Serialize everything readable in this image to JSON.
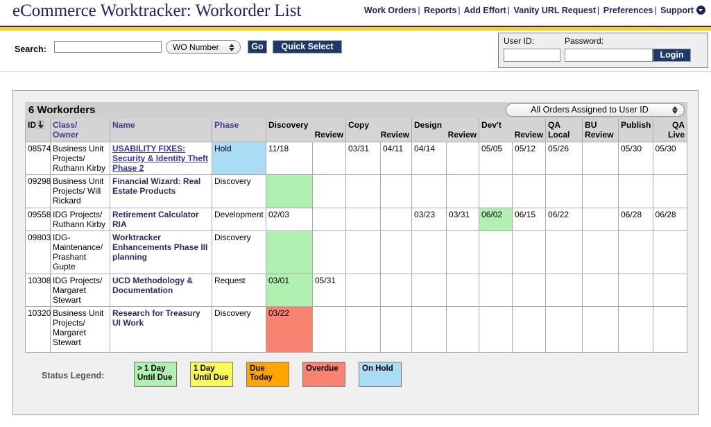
{
  "header": {
    "app_title": "eCommerce Worktracker: Workorder List",
    "nav": [
      {
        "label": "Work Orders"
      },
      {
        "label": "Reports"
      },
      {
        "label": "Add Effort"
      },
      {
        "label": "Vanity URL Request"
      },
      {
        "label": "Preferences"
      },
      {
        "label": "Support"
      }
    ],
    "nav_separator": "|",
    "support_icon": "caret-down-circle-icon"
  },
  "search": {
    "label": "Search:",
    "input_value": "",
    "input_placeholder": "",
    "type_selected": "WO Number",
    "go_label": "Go",
    "quick_select_label": "Quick Select"
  },
  "login": {
    "userid_label": "User ID:",
    "password_label": "Password:",
    "userid_value": "",
    "password_value": "",
    "login_label": "Login"
  },
  "panel": {
    "count_label": "6 Workorders",
    "filter_selected": "All Orders Assigned to User ID"
  },
  "table": {
    "columns": [
      {
        "main": "ID",
        "sub": "",
        "link": false,
        "sorted": true
      },
      {
        "main": "Class/",
        "sub": "Owner",
        "link": true,
        "sub_align": "left"
      },
      {
        "main": "Name",
        "sub": "",
        "link": true
      },
      {
        "main": "Phase",
        "sub": "",
        "link": true
      },
      {
        "main": "Discovery",
        "sub": "Review",
        "link": false
      },
      {
        "main": "Copy",
        "sub": "Review",
        "link": false
      },
      {
        "main": "Design",
        "sub": "Review",
        "link": false
      },
      {
        "main": "Dev't",
        "sub": "Review",
        "link": false
      },
      {
        "main": "QA Local",
        "sub": "",
        "link": false
      },
      {
        "main": "BU",
        "sub": "Review",
        "link": false,
        "sub_align": "left"
      },
      {
        "main": "Publish",
        "sub": "",
        "link": false
      },
      {
        "main": "",
        "sub": "QA Live",
        "link": false
      }
    ],
    "rows": [
      {
        "id": "08574",
        "owner": "Business Unit Projects/ Ruthann Kirby",
        "name": "USABILITY FIXES: Security & Identity Theft Phase 2",
        "name_is_link": true,
        "phase": "Hold",
        "phase_color": "bg-blue",
        "discovery": "11/18",
        "discovery_color": "",
        "discovery_review": "",
        "copy": "03/31",
        "copy_review": "04/11",
        "design": "04/14",
        "design_review": "",
        "devt": "05/05",
        "devt_review": "05/12",
        "qa_local": "05/26",
        "bu_review": "",
        "publish": "05/30",
        "qa_live": "05/30"
      },
      {
        "id": "09298",
        "owner": "Business Unit Projects/ Will Rickard",
        "name": "Financial Wizard: Real Estate Products",
        "name_is_link": false,
        "phase": "Discovery",
        "phase_color": "",
        "discovery": "",
        "discovery_color": "bg-green",
        "discovery_review": "",
        "copy": "",
        "copy_review": "",
        "design": "",
        "design_review": "",
        "devt": "",
        "devt_review": "",
        "qa_local": "",
        "bu_review": "",
        "publish": "",
        "qa_live": ""
      },
      {
        "id": "09558",
        "owner": "IDG Projects/ Ruthann Kirby",
        "name": "Retirement Calculator RIA",
        "name_is_link": false,
        "phase": "Development",
        "phase_color": "",
        "discovery": "02/03",
        "discovery_color": "",
        "discovery_review": "",
        "copy": "",
        "copy_review": "",
        "design": "03/23",
        "design_review": "03/31",
        "devt": "06/02",
        "devt_color": "bg-green",
        "devt_review": "06/15",
        "qa_local": "06/22",
        "bu_review": "",
        "publish": "06/28",
        "qa_live": "06/28"
      },
      {
        "id": "09803",
        "owner": "IDG-Maintenance/ Prashant Gupte",
        "name": "Worktracker Enhancements Phase III planning",
        "name_is_link": false,
        "phase": "Discovery",
        "phase_color": "",
        "discovery": "",
        "discovery_color": "bg-green",
        "discovery_review": "",
        "copy": "",
        "copy_review": "",
        "design": "",
        "design_review": "",
        "devt": "",
        "devt_review": "",
        "qa_local": "",
        "bu_review": "",
        "publish": "",
        "qa_live": ""
      },
      {
        "id": "10308",
        "owner": "IDG Projects/ Margaret Stewart",
        "name": "UCD Methodology & Documentation",
        "name_is_link": false,
        "phase": "Request",
        "phase_color": "",
        "discovery": "03/01",
        "discovery_color": "bg-green",
        "discovery_review": "05/31",
        "copy": "",
        "copy_review": "",
        "design": "",
        "design_review": "",
        "devt": "",
        "devt_review": "",
        "qa_local": "",
        "bu_review": "",
        "publish": "",
        "qa_live": ""
      },
      {
        "id": "10320",
        "owner": "Business Unit Projects/ Margaret Stewart",
        "name": "Research for Treasury UI Work",
        "name_is_link": false,
        "phase": "Discovery",
        "phase_color": "",
        "discovery": "03/22",
        "discovery_color": "bg-red",
        "discovery_review": "",
        "copy": "",
        "copy_review": "",
        "design": "",
        "design_review": "",
        "devt": "",
        "devt_review": "",
        "qa_local": "",
        "bu_review": "",
        "publish": "",
        "qa_live": ""
      }
    ]
  },
  "legend": {
    "label": "Status Legend:",
    "items": [
      {
        "line1": "> 1 Day",
        "line2": "Until Due",
        "color_class": "bg-green",
        "hex": "#b0f0b0"
      },
      {
        "line1": "1 Day",
        "line2": "Until Due",
        "color_class": "bg-yellow",
        "hex": "#fbfb55"
      },
      {
        "line1": "Due",
        "line2": "Today",
        "color_class": "bg-orange",
        "hex": "#ffa500"
      },
      {
        "line1": "Overdue",
        "line2": "",
        "color_class": "bg-red",
        "hex": "#f98271"
      },
      {
        "line1": "On Hold",
        "line2": "",
        "color_class": "bg-blue",
        "hex": "#aadcf5"
      }
    ]
  },
  "colors": {
    "brand_navy": "#222266",
    "gold_rule": "#fccc17",
    "button_navy": "#1b3a6b",
    "panel_bg": "#f0f0f0",
    "table_header_bg": "#d4d4d4"
  }
}
